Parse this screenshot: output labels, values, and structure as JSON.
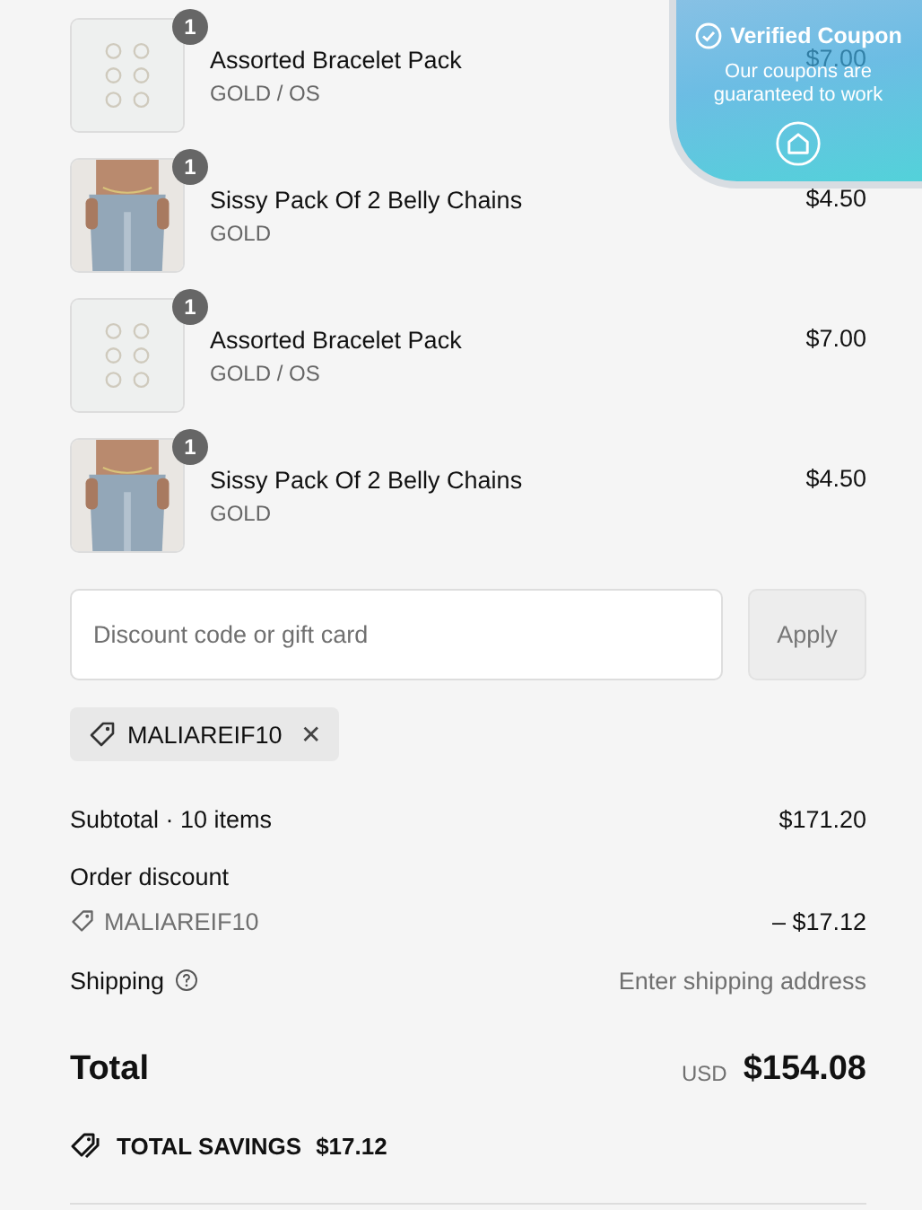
{
  "items": [
    {
      "name": "Assorted Bracelet Pack",
      "variant": "GOLD / OS",
      "price": "$7.00",
      "quantity": "1"
    },
    {
      "name": "Sissy Pack Of 2 Belly Chains",
      "variant": "GOLD",
      "price": "$4.50",
      "quantity": "1"
    },
    {
      "name": "Assorted Bracelet Pack",
      "variant": "GOLD / OS",
      "price": "$7.00",
      "quantity": "1"
    },
    {
      "name": "Sissy Pack Of 2 Belly Chains",
      "variant": "GOLD",
      "price": "$4.50",
      "quantity": "1"
    }
  ],
  "discount": {
    "placeholder": "Discount code or gift card",
    "button": "Apply",
    "button_disabled": true
  },
  "applied_code": {
    "code": "MALIAREIF10",
    "remove": "✕"
  },
  "summary": {
    "subtotal_label": "Subtotal · 10 items",
    "subtotal": "$171.20",
    "discount_label": "Order discount",
    "discount_code": "MALIAREIF10",
    "discount_amount": "– $17.12",
    "shipping_label": "Shipping",
    "shipping_value": "Enter shipping address",
    "total_label": "Total",
    "currency": "USD",
    "total": "$154.08",
    "savings_label": "TOTAL SAVINGS",
    "savings": "$17.12"
  },
  "coupon_popup": {
    "title": "Verified Coupon",
    "message": "Our coupons are guaranteed to work"
  }
}
